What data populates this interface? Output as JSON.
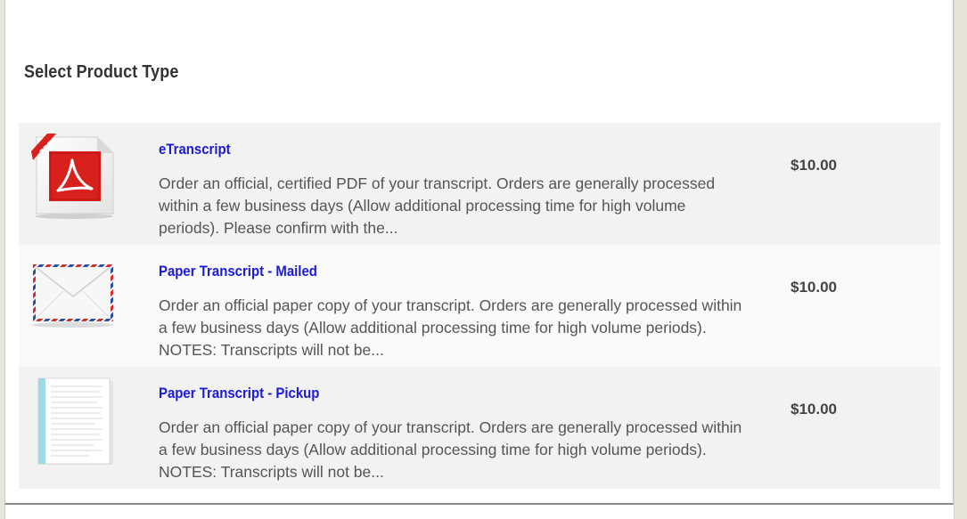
{
  "page": {
    "heading": "Select Product Type"
  },
  "products": [
    {
      "icon": "pdf-document-icon",
      "title": "eTranscript",
      "description": "Order an official, certified PDF of your transcript. Orders are generally processed within a few business days (Allow additional processing time for high volume periods). Please confirm with the...",
      "price": "$10.00",
      "badge": "PDF"
    },
    {
      "icon": "airmail-envelope-icon",
      "title": "Paper Transcript - Mailed",
      "description": "Order an official paper copy of your transcript. Orders are generally processed within a few business days (Allow additional processing time for high volume periods). NOTES: Transcripts will not be...",
      "price": "$10.00"
    },
    {
      "icon": "paper-document-icon",
      "title": "Paper Transcript - Pickup",
      "description": "Order an official paper copy of your transcript. Orders are generally processed within a few business days (Allow additional processing time for high volume periods). NOTES: Transcripts will not be...",
      "price": "$10.00"
    }
  ],
  "colors": {
    "link": "#1a1ad8",
    "row_alt_1": "#f2f2f2",
    "row_alt_2": "#fafafa",
    "pdf_red": "#d8201c"
  }
}
